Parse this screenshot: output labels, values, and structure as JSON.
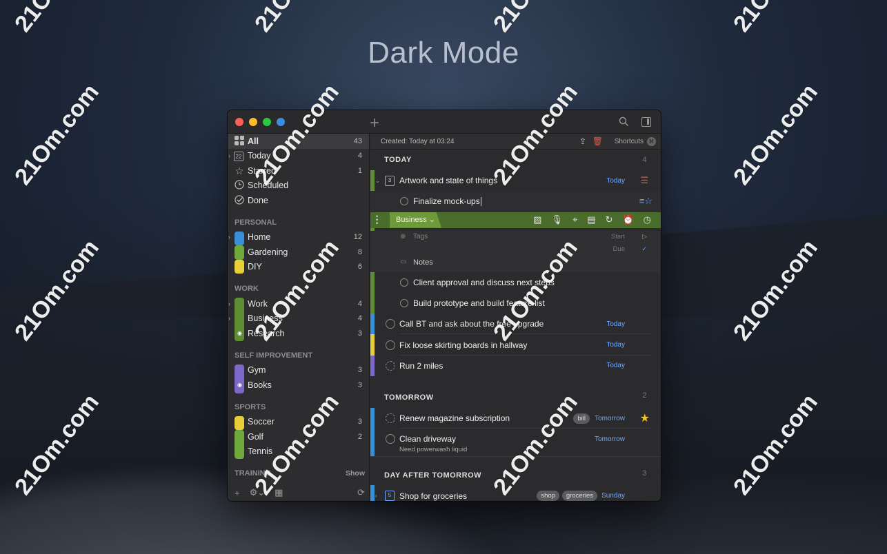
{
  "hero": {
    "title": "Dark Mode"
  },
  "watermark": "21Om.com",
  "window": {
    "toolbar": {
      "add_icon": "plus-icon",
      "search_icon": "search-icon",
      "panel_icon": "sidebar-panel-icon"
    },
    "sidebar": {
      "top_items": [
        {
          "label": "All",
          "count": "43",
          "icon": "grid-icon"
        },
        {
          "label": "Today",
          "count": "4",
          "icon": "calendar-22-icon"
        },
        {
          "label": "Starred",
          "count": "1",
          "icon": "star-icon"
        },
        {
          "label": "Scheduled",
          "count": "",
          "icon": "clock-icon"
        },
        {
          "label": "Done",
          "count": "",
          "icon": "check-circle-icon"
        }
      ],
      "groups": [
        {
          "name": "PERSONAL",
          "items": [
            {
              "label": "Home",
              "count": "12",
              "color": "#3a8fd9"
            },
            {
              "label": "Gardening",
              "count": "8",
              "color": "#6fa83b"
            },
            {
              "label": "DIY",
              "count": "6",
              "color": "#e8cf3a"
            }
          ]
        },
        {
          "name": "WORK",
          "items": [
            {
              "label": "Work",
              "count": "4",
              "color": "#5f8d33"
            },
            {
              "label": "Business",
              "count": "4",
              "color": "#5f8d33"
            },
            {
              "label": "Research",
              "count": "3",
              "color": "#5f8d33"
            }
          ]
        },
        {
          "name": "SELF IMPROVEMENT",
          "items": [
            {
              "label": "Gym",
              "count": "3",
              "color": "#7b68c9"
            },
            {
              "label": "Books",
              "count": "3",
              "color": "#7b68c9"
            }
          ]
        },
        {
          "name": "SPORTS",
          "items": [
            {
              "label": "Soccer",
              "count": "3",
              "color": "#e8cf3a"
            },
            {
              "label": "Golf",
              "count": "2",
              "color": "#6fa83b"
            },
            {
              "label": "Tennis",
              "count": "",
              "color": "#6fa83b"
            }
          ]
        }
      ],
      "trailing": {
        "name": "TRAINING",
        "show": "Show"
      }
    },
    "info": {
      "created": "Created: Today at 03:24",
      "shortcuts": "Shortcuts"
    },
    "sections": {
      "today": {
        "title": "TODAY",
        "count": "4"
      },
      "tomorrow": {
        "title": "TOMORROW",
        "count": "2"
      },
      "day_after": {
        "title": "DAY AFTER TOMORROW",
        "count": "3"
      }
    },
    "tasks": {
      "artwork": {
        "title": "Artwork and state of things",
        "when": "Today",
        "cal": "3"
      },
      "finalize": {
        "title": "Finalize mock-ups"
      },
      "editor": {
        "project": "Business",
        "tags": "Tags",
        "start": "Start",
        "due": "Due",
        "notes": "Notes"
      },
      "client": {
        "title": "Client approval and discuss next steps"
      },
      "build": {
        "title": "Build prototype and build feature list"
      },
      "callbt": {
        "title": "Call BT and ask about the free upgrade",
        "when": "Today"
      },
      "skirting": {
        "title": "Fix loose skirting boards in hallway",
        "when": "Today"
      },
      "run": {
        "title": "Run 2 miles",
        "when": "Today"
      },
      "magazine": {
        "title": "Renew magazine subscription",
        "when": "Tomorrow",
        "tag": "bill"
      },
      "driveway": {
        "title": "Clean driveway",
        "when": "Tomorrow",
        "note": "Need powerwash liquid"
      },
      "groceries": {
        "title": "Shop for groceries",
        "when": "Sunday",
        "cal": "5",
        "tags": [
          "shop",
          "groceries"
        ]
      }
    }
  }
}
